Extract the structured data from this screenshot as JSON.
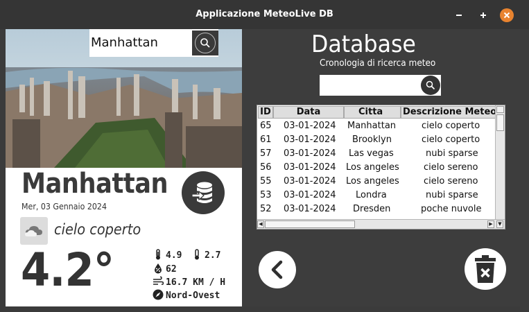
{
  "window": {
    "title": "Applicazione MeteoLive DB"
  },
  "search": {
    "value": "Manhattan"
  },
  "weather": {
    "city": "Manhattan",
    "date": "Mer, 03 Gennaio 2024",
    "condition": "cielo coperto",
    "temperature": "4.2°",
    "temp_max": "4.9",
    "temp_min": "2.7",
    "humidity": "62",
    "wind": "16.7 KM / H",
    "direction": "Nord-Ovest"
  },
  "history": {
    "title": "Database",
    "subtitle": "Cronologia di ricerca meteo",
    "search_value": "",
    "columns": [
      "ID",
      "Data",
      "Citta",
      "Descrizione Meteo"
    ],
    "rows": [
      [
        "65",
        "03-01-2024",
        "Manhattan",
        "cielo coperto"
      ],
      [
        "61",
        "03-01-2024",
        "Brooklyn",
        "cielo coperto"
      ],
      [
        "57",
        "03-01-2024",
        "Las vegas",
        "nubi sparse"
      ],
      [
        "56",
        "03-01-2024",
        "Los angeles",
        "cielo sereno"
      ],
      [
        "55",
        "03-01-2024",
        "Los angeles",
        "cielo sereno"
      ],
      [
        "53",
        "03-01-2024",
        "Londra",
        "nubi sparse"
      ],
      [
        "52",
        "03-01-2024",
        "Dresden",
        "poche nuvole"
      ]
    ]
  },
  "colors": {
    "panel": "#3d3d3d",
    "close": "#e8832f",
    "dark_button": "#3a3a3a"
  },
  "icons": {
    "search": "search-icon",
    "database": "database-import-icon",
    "back": "chevron-left-icon",
    "trash": "trash-icon",
    "cloud": "cloud-icon"
  }
}
